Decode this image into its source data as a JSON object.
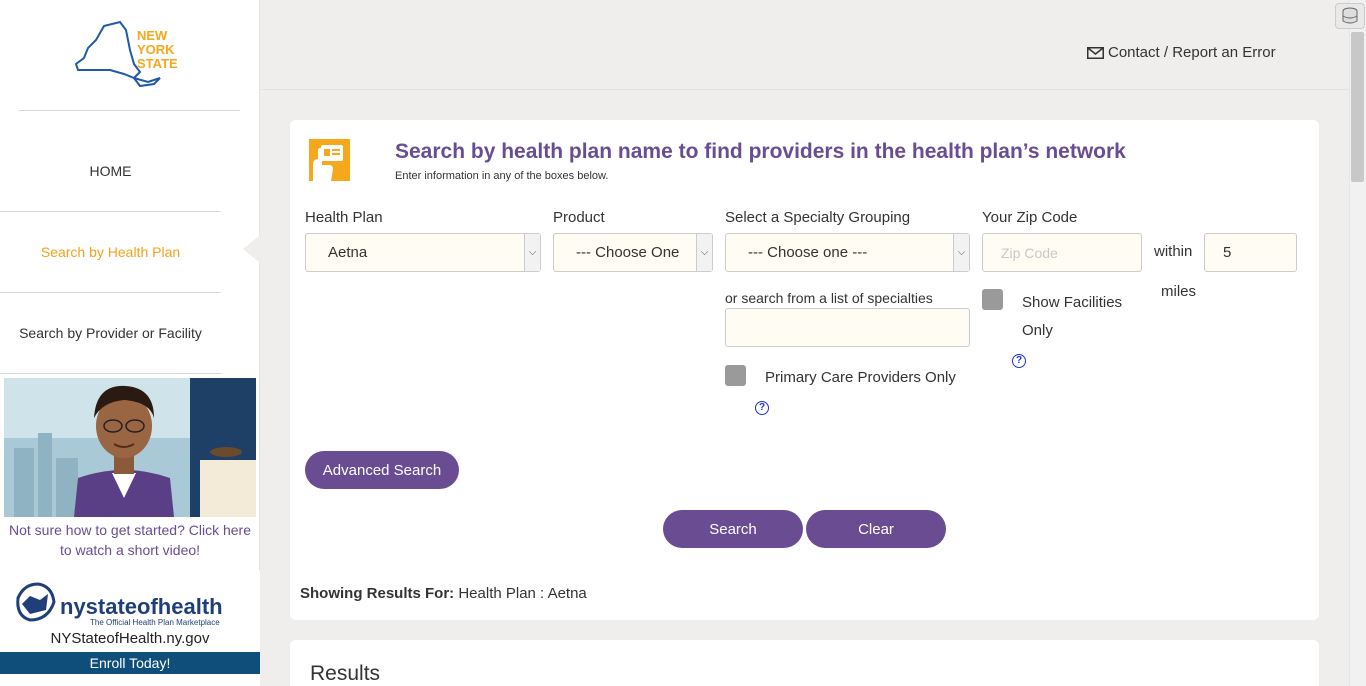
{
  "logo": {
    "line1": "NEW",
    "line2": "YORK",
    "line3": "STATE"
  },
  "header": {
    "contact_label": "Contact / Report an Error",
    "contact_icon": "envelope-icon"
  },
  "sidebar": {
    "items": [
      {
        "label": "HOME"
      },
      {
        "label": "Search by Health Plan"
      },
      {
        "label": "Search by Provider or Facility"
      }
    ],
    "video_caption": "Not sure how to get started? Click here to watch a short video!",
    "nysoh": {
      "brand": "nystateofhealth",
      "tagline": "The Official Health Plan Marketplace",
      "url": "NYStateofHealth.ny.gov",
      "enroll": "Enroll Today!"
    }
  },
  "search": {
    "title": "Search by health plan name to find providers in the health plan’s network",
    "subtitle": "Enter information in any of the boxes below.",
    "health_plan": {
      "label": "Health Plan",
      "value": "Aetna"
    },
    "product": {
      "label": "Product",
      "value": "--- Choose One"
    },
    "specialty": {
      "label": "Select a Specialty Grouping",
      "value": "--- Choose one ---"
    },
    "specialty_list_label": "or search from a list of specialties",
    "zip": {
      "label": "Your Zip Code",
      "placeholder": "Zip Code"
    },
    "within_label": "within",
    "miles_value": "5",
    "miles_label": "miles",
    "facilities_only_label_1": "Show Facilities",
    "facilities_only_label_2": "Only",
    "primary_care_label": "Primary Care Providers Only",
    "help_glyph": "?",
    "advanced_label": "Advanced Search",
    "search_label": "Search",
    "clear_label": "Clear",
    "showing_prefix": "Showing Results For:",
    "showing_value": "Health Plan : Aetna"
  },
  "results": {
    "title": "Results"
  },
  "colors": {
    "accent": "#6a4c93",
    "highlight": "#f0a31c",
    "nys_blue": "#1f5aa6"
  }
}
